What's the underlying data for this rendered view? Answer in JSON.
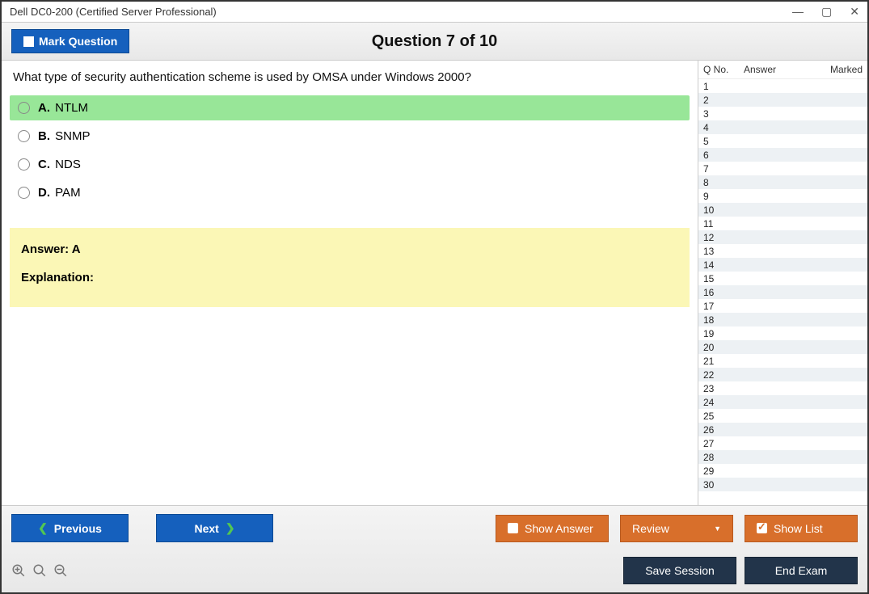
{
  "window": {
    "title": "Dell DC0-200 (Certified Server Professional)"
  },
  "header": {
    "mark_question_label": "Mark Question",
    "question_counter": "Question 7 of 10"
  },
  "question": {
    "text": "What type of security authentication scheme is used by OMSA under Windows 2000?",
    "options": [
      {
        "letter": "A.",
        "text": "NTLM",
        "correct": true
      },
      {
        "letter": "B.",
        "text": "SNMP",
        "correct": false
      },
      {
        "letter": "C.",
        "text": "NDS",
        "correct": false
      },
      {
        "letter": "D.",
        "text": "PAM",
        "correct": false
      }
    ],
    "answer_label": "Answer: A",
    "explanation_label": "Explanation:"
  },
  "sidebar": {
    "col_q": "Q No.",
    "col_answer": "Answer",
    "col_marked": "Marked",
    "rows": [
      1,
      2,
      3,
      4,
      5,
      6,
      7,
      8,
      9,
      10,
      11,
      12,
      13,
      14,
      15,
      16,
      17,
      18,
      19,
      20,
      21,
      22,
      23,
      24,
      25,
      26,
      27,
      28,
      29,
      30
    ]
  },
  "footer": {
    "previous": "Previous",
    "next": "Next",
    "show_answer": "Show Answer",
    "review": "Review",
    "show_list": "Show List",
    "save_session": "Save Session",
    "end_exam": "End Exam"
  }
}
